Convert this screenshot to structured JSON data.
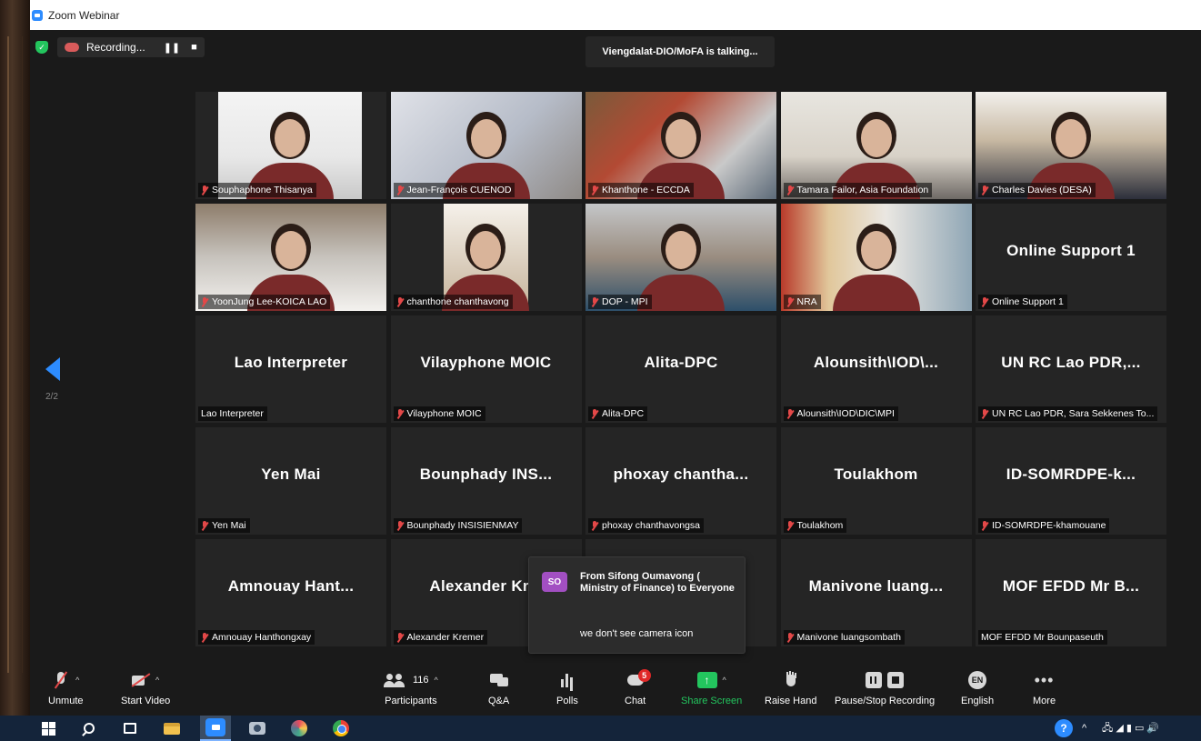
{
  "window": {
    "title": "Zoom Webinar"
  },
  "recording": {
    "label": "Recording...",
    "pause_glyph": "❚❚",
    "stop_glyph": "■"
  },
  "talking_banner": "Viengdalat-DIO/MoFA is talking...",
  "pager": {
    "indicator": "2/2"
  },
  "tiles": [
    {
      "label": "Souphaphone Thisanya",
      "muted": true,
      "video": "v1"
    },
    {
      "label": "Jean-François CUENOD",
      "muted": true,
      "video": "v2"
    },
    {
      "label": "Khanthone - ECCDA",
      "muted": true,
      "video": "v3"
    },
    {
      "label": "Tamara Failor, Asia Foundation",
      "muted": true,
      "video": "v4"
    },
    {
      "label": "Charles Davies (DESA)",
      "muted": true,
      "video": "v5"
    },
    {
      "label": "YoonJung Lee-KOICA LAO",
      "muted": true,
      "video": "v6"
    },
    {
      "label": "chanthone chanthavong",
      "muted": true,
      "video": "v7"
    },
    {
      "label": "DOP - MPI",
      "muted": true,
      "video": "v8"
    },
    {
      "label": "NRA",
      "muted": true,
      "video": "v9"
    },
    {
      "label": "Online Support 1",
      "muted": true,
      "display_name": "Online Support 1"
    },
    {
      "label": "Lao Interpreter",
      "muted": false,
      "display_name": "Lao Interpreter"
    },
    {
      "label": "Vilayphone MOIC",
      "muted": true,
      "display_name": "Vilayphone MOIC"
    },
    {
      "label": "Alita-DPC",
      "muted": true,
      "display_name": "Alita-DPC"
    },
    {
      "label": "Alounsith\\IOD\\DIC\\MPI",
      "muted": true,
      "display_name": "Alounsith\\IOD\\..."
    },
    {
      "label": "UN RC Lao PDR, Sara Sekkenes To...",
      "muted": true,
      "display_name": "UN RC Lao PDR,..."
    },
    {
      "label": "Yen Mai",
      "muted": true,
      "display_name": "Yen Mai"
    },
    {
      "label": "Bounphady INSISIENMAY",
      "muted": true,
      "display_name": "Bounphady INS..."
    },
    {
      "label": "phoxay chanthavongsa",
      "muted": true,
      "display_name": "phoxay chantha..."
    },
    {
      "label": "Toulakhom",
      "muted": true,
      "display_name": "Toulakhom"
    },
    {
      "label": "ID-SOMRDPE-khamouane",
      "muted": true,
      "display_name": "ID-SOMRDPE-k..."
    },
    {
      "label": "Amnouay Hanthongxay",
      "muted": true,
      "display_name": "Amnouay Hant..."
    },
    {
      "label": "Alexander Kremer",
      "muted": true,
      "display_name": "Alexander Krei"
    },
    {
      "label": "",
      "muted": false,
      "display_name": "..."
    },
    {
      "label": "Manivone luangsombath",
      "muted": true,
      "display_name": "Manivone luang..."
    },
    {
      "label": "MOF EFDD Mr Bounpaseuth",
      "muted": false,
      "display_name": "MOF EFDD Mr B..."
    }
  ],
  "chat_toast": {
    "avatar": "SO",
    "from": "From Sifong Oumavong ( Ministry of Finance) to Everyone",
    "message": "we don't see camera icon"
  },
  "toolbar": {
    "unmute": "Unmute",
    "start_video": "Start Video",
    "participants": "Participants",
    "participants_count": "116",
    "qa": "Q&A",
    "polls": "Polls",
    "chat": "Chat",
    "chat_badge": "5",
    "share_screen": "Share Screen",
    "raise_hand": "Raise Hand",
    "pause_stop_recording": "Pause/Stop Recording",
    "language": "English",
    "language_code": "EN",
    "more": "More",
    "caret": "^",
    "more_glyph": "•••",
    "share_arrow": "↑"
  },
  "taskbar": {
    "help": "?",
    "tray_caret": "^",
    "tray_icons": "🖧 ◢ ▮ ▭ 🔊"
  },
  "colors": {
    "accent": "#2d8cff",
    "share_green": "#23c55e",
    "muted_red": "#e34848",
    "badge_red": "#e02828",
    "toast_avatar": "#a24fc2"
  }
}
